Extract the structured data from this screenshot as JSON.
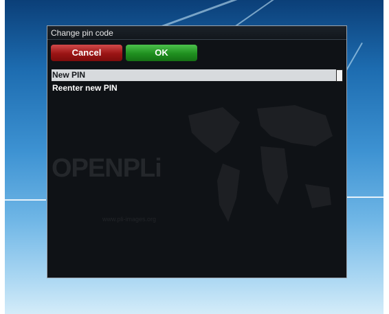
{
  "dialog": {
    "title": "Change pin code",
    "cancel_label": "Cancel",
    "ok_label": "OK",
    "fields": [
      {
        "label": "New PIN",
        "selected": true
      },
      {
        "label": "Reenter new PIN",
        "selected": false
      }
    ]
  },
  "background": {
    "logo_text": "OPENPLi",
    "url_text": "www.pli-images.org"
  },
  "colors": {
    "cancel": "#9a1414",
    "ok": "#1f8f1f",
    "selected_row": "#d7dadd"
  }
}
